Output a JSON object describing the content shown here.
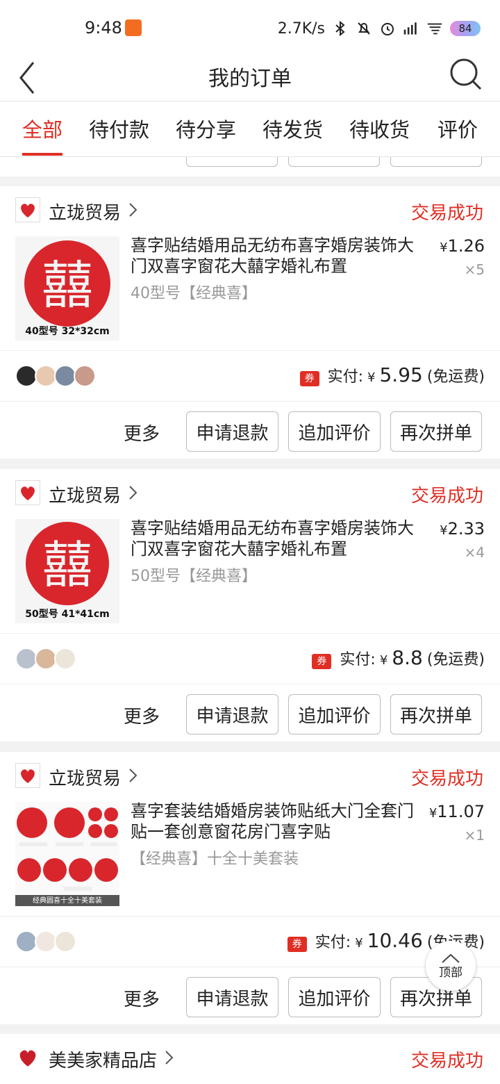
{
  "status_bar": {
    "time": "9:48",
    "network_speed": "2.7K/s",
    "battery": "84",
    "icons": [
      "bluetooth-icon",
      "mute-icon",
      "alarm-icon",
      "signal-icon",
      "wifi-icon",
      "battery-icon"
    ]
  },
  "header": {
    "title": "我的订单",
    "back_icon": "back-arrow-icon",
    "search_icon": "search-icon"
  },
  "tabs": [
    {
      "label": "全部",
      "active": true
    },
    {
      "label": "待付款",
      "active": false
    },
    {
      "label": "待分享",
      "active": false
    },
    {
      "label": "待发货",
      "active": false
    },
    {
      "label": "待收货",
      "active": false
    },
    {
      "label": "评价",
      "active": false
    }
  ],
  "orders": [
    {
      "shop": "立珑贸易",
      "status": "交易成功",
      "product_name": "喜字贴结婚用品无纺布喜字婚房装饰大门双喜字窗花大囍字婚礼布置",
      "spec": "40型号【经典喜】",
      "thumb_label": "40型号 32*32cm",
      "price": "1.26",
      "qty": "×5",
      "pay_label": "实付:",
      "pay_amount": "5.95",
      "shipping": "(免运费)",
      "coupon": "券"
    },
    {
      "shop": "立珑贸易",
      "status": "交易成功",
      "product_name": "喜字贴结婚用品无纺布喜字婚房装饰大门双喜字窗花大囍字婚礼布置",
      "spec": "50型号【经典喜】",
      "thumb_label": "50型号 41*41cm",
      "price": "2.33",
      "qty": "×4",
      "pay_label": "实付:",
      "pay_amount": "8.8",
      "shipping": "(免运费)",
      "coupon": "券"
    },
    {
      "shop": "立珑贸易",
      "status": "交易成功",
      "product_name": "喜字套装结婚婚房装饰贴纸大门全套门贴一套创意窗花房门喜字贴",
      "spec": "【经典喜】十全十美套装",
      "thumb_label": "经典圆喜十全十美套装",
      "price": "11.07",
      "qty": "×1",
      "pay_label": "实付:",
      "pay_amount": "10.46",
      "shipping": "(免运费)",
      "coupon": "券"
    }
  ],
  "actions": {
    "more": "更多",
    "refund": "申请退款",
    "add_review": "追加评价",
    "reorder": "再次拼单"
  },
  "next_order": {
    "shop": "美美家精品店",
    "status": "交易成功"
  },
  "yen": "¥",
  "to_top": "顶部",
  "colors": {
    "accent": "#e02e24",
    "muted": "#999999"
  }
}
